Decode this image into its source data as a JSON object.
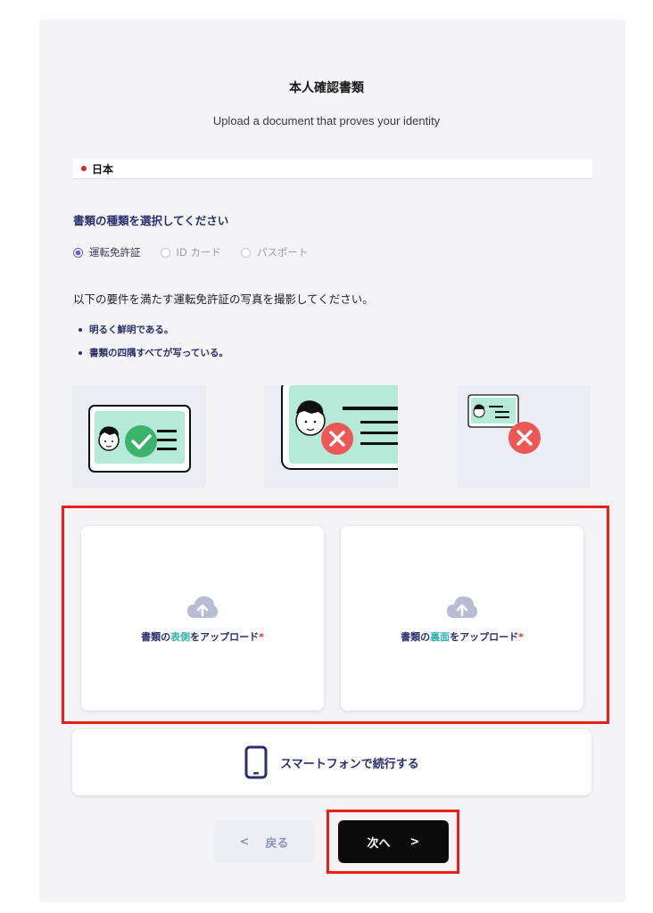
{
  "header": {
    "title": "本人確認書類",
    "subtitle": "Upload a document that proves your identity"
  },
  "country": {
    "name": "日本",
    "flag_color": "#e02424"
  },
  "document_type": {
    "label": "書類の種類を選択してください",
    "options": [
      {
        "label": "運転免許証",
        "selected": true
      },
      {
        "label": "ID カード",
        "selected": false
      },
      {
        "label": "パスポート",
        "selected": false
      }
    ]
  },
  "instructions": {
    "text": "以下の要件を満たす運転免許証の写真を撮影してください。",
    "requirements": [
      "明るく鮮明である。",
      "書類の四隅すべてが写っている。"
    ]
  },
  "examples": [
    {
      "status": "good",
      "icon": "check-icon",
      "color": "#3bb36a"
    },
    {
      "status": "bad-too-close",
      "icon": "x-icon",
      "color": "#ef5656"
    },
    {
      "status": "bad-too-far",
      "icon": "x-icon",
      "color": "#ef5656"
    }
  ],
  "upload": {
    "front": {
      "prefix": "書類の",
      "accent": "表側",
      "suffix": "をアップロード",
      "required": "*"
    },
    "back": {
      "prefix": "書類の",
      "accent": "裏面",
      "suffix": "をアップロード",
      "required": "*"
    },
    "icon": "cloud-upload-icon"
  },
  "smartphone": {
    "label": "スマートフォンで続行する",
    "icon": "smartphone-icon"
  },
  "nav": {
    "back_icon": "<",
    "back_label": "戻る",
    "next_label": "次へ",
    "next_icon": ">"
  },
  "colors": {
    "accent": "#30b3ae",
    "primary_text": "#2a2f6b",
    "highlight_outline": "#ee1c1c",
    "card_illustration": "#b6ead8"
  }
}
